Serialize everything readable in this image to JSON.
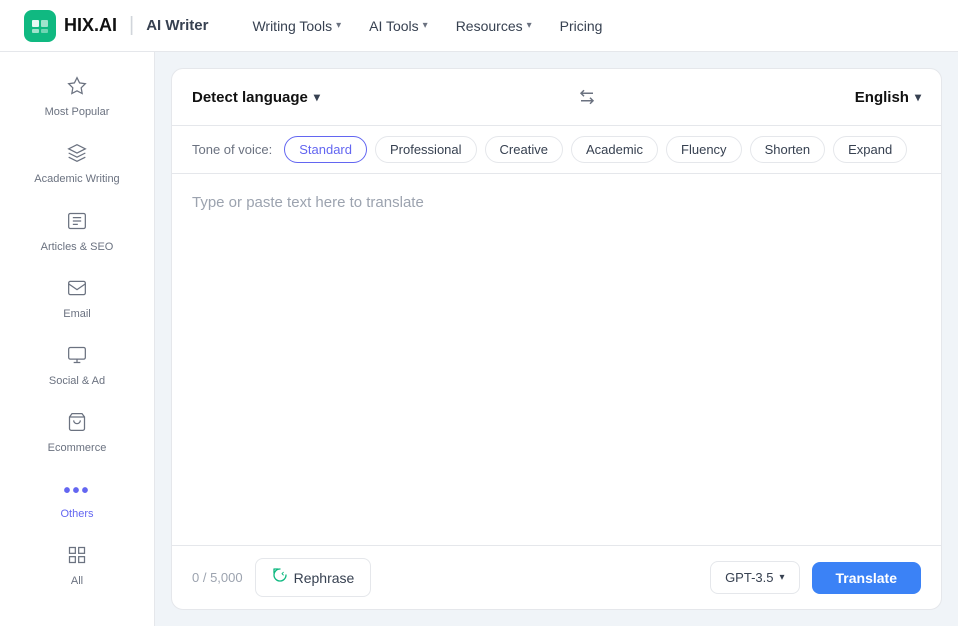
{
  "navbar": {
    "logo_text": "HIX.AI",
    "logo_icon": "H",
    "separator": "|",
    "subtitle": "AI Writer",
    "nav_items": [
      {
        "label": "Writing Tools",
        "has_chevron": true
      },
      {
        "label": "AI Tools",
        "has_chevron": true
      },
      {
        "label": "Resources",
        "has_chevron": true
      }
    ],
    "pricing_label": "Pricing"
  },
  "sidebar": {
    "items": [
      {
        "id": "most-popular",
        "label": "Most Popular",
        "icon": "⊞"
      },
      {
        "id": "academic-writing",
        "label": "Academic Writing",
        "icon": "✏"
      },
      {
        "id": "articles-seo",
        "label": "Articles & SEO",
        "icon": "▣"
      },
      {
        "id": "email",
        "label": "Email",
        "icon": "✉"
      },
      {
        "id": "social-ad",
        "label": "Social & Ad",
        "icon": "🖥"
      },
      {
        "id": "ecommerce",
        "label": "Ecommerce",
        "icon": "🛒"
      },
      {
        "id": "others",
        "label": "Others",
        "icon": "•••",
        "active": true
      },
      {
        "id": "all",
        "label": "All",
        "icon": "⊞"
      }
    ]
  },
  "translator": {
    "source_lang": "Detect language",
    "target_lang": "English",
    "swap_icon": "⇄",
    "tone_label": "Tone of voice:",
    "tones": [
      {
        "id": "standard",
        "label": "Standard",
        "active": true
      },
      {
        "id": "professional",
        "label": "Professional"
      },
      {
        "id": "creative",
        "label": "Creative"
      },
      {
        "id": "academic",
        "label": "Academic"
      },
      {
        "id": "fluency",
        "label": "Fluency"
      },
      {
        "id": "shorten",
        "label": "Shorten"
      },
      {
        "id": "expand",
        "label": "Expand"
      }
    ],
    "placeholder": "Type or paste text here to translate",
    "char_count": "0 / 5,000",
    "rephrase_label": "Rephrase",
    "gpt_model": "GPT-3.5",
    "translate_label": "Translate"
  }
}
